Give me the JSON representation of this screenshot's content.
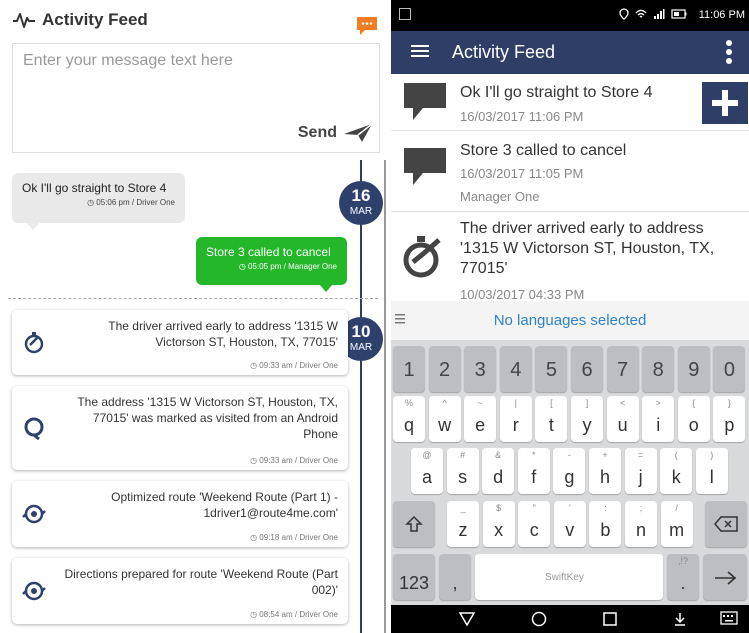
{
  "left": {
    "title": "Activity Feed",
    "composer": {
      "placeholder": "Enter your message text here",
      "send_label": "Send"
    },
    "dates": [
      {
        "day": "16",
        "month": "MAR"
      },
      {
        "day": "10",
        "month": "MAR"
      }
    ],
    "bubbles": [
      {
        "text": "Ok I'll go straight to Store 4",
        "meta": "05:06 pm / Driver One"
      },
      {
        "text": "Store 3 called to cancel",
        "meta": "05:05 pm / Manager One"
      }
    ],
    "cards": [
      {
        "text": "The driver arrived early to address '1315 W Victorson ST, Houston, TX, 77015'",
        "meta": "09:33 am / Driver One",
        "icon": "stopwatch-icon"
      },
      {
        "text": "The address '1315 W Victorson ST, Houston, TX, 77015' was marked as visited from an Android Phone",
        "meta": "09:33 am / Driver One",
        "icon": "map-pin-check-icon"
      },
      {
        "text": "Optimized route 'Weekend Route (Part 1) - 1driver1@route4me.com'",
        "meta": "09:18 am / Driver One",
        "icon": "route-optimize-icon"
      },
      {
        "text": "Directions prepared for route 'Weekend Route (Part 002)'",
        "meta": "08:54 am / Driver One",
        "icon": "route-optimize-icon"
      }
    ]
  },
  "phone": {
    "status_time": "11:06 PM",
    "appbar_title": "Activity Feed",
    "feed": [
      {
        "title": "Ok I'll go straight to Store 4",
        "date": "16/03/2017 11:06 PM",
        "user": ""
      },
      {
        "title": "Store 3 called to cancel",
        "date": "16/03/2017 11:05 PM",
        "user": "Manager One"
      },
      {
        "title": "The driver arrived early to address '1315 W Victorson ST, Houston, TX, 77015'",
        "date": "10/03/2017 04:33 PM",
        "user": ""
      }
    ],
    "keyboard": {
      "banner": "No languages selected",
      "numbers": [
        "1",
        "2",
        "3",
        "4",
        "5",
        "6",
        "7",
        "8",
        "9",
        "0"
      ],
      "row1": [
        [
          "q",
          "%"
        ],
        [
          "w",
          "^"
        ],
        [
          "e",
          "~"
        ],
        [
          "r",
          "|"
        ],
        [
          "t",
          "["
        ],
        [
          "y",
          "]"
        ],
        [
          "u",
          "<"
        ],
        [
          "i",
          ">"
        ],
        [
          "o",
          "{"
        ],
        [
          "p",
          "}"
        ]
      ],
      "row2": [
        [
          "a",
          "@"
        ],
        [
          "s",
          "#"
        ],
        [
          "d",
          "&"
        ],
        [
          "f",
          "*"
        ],
        [
          "g",
          "-"
        ],
        [
          "h",
          "+"
        ],
        [
          "j",
          "="
        ],
        [
          "k",
          "("
        ],
        [
          "l",
          ")"
        ]
      ],
      "row3": [
        [
          "z",
          "_"
        ],
        [
          "x",
          "$"
        ],
        [
          "c",
          "\""
        ],
        [
          "v",
          "'"
        ],
        [
          "b",
          ":"
        ],
        [
          "n",
          ";"
        ],
        [
          "m",
          "/"
        ]
      ],
      "sym_label": "123",
      "comma": ",",
      "period": ".",
      "period_sub": ",!?",
      "brand": "SwiftKey"
    }
  },
  "colors": {
    "navy": "#2e3e66",
    "green": "#23b729",
    "orange": "#f47b20",
    "link": "#2f82c9"
  }
}
